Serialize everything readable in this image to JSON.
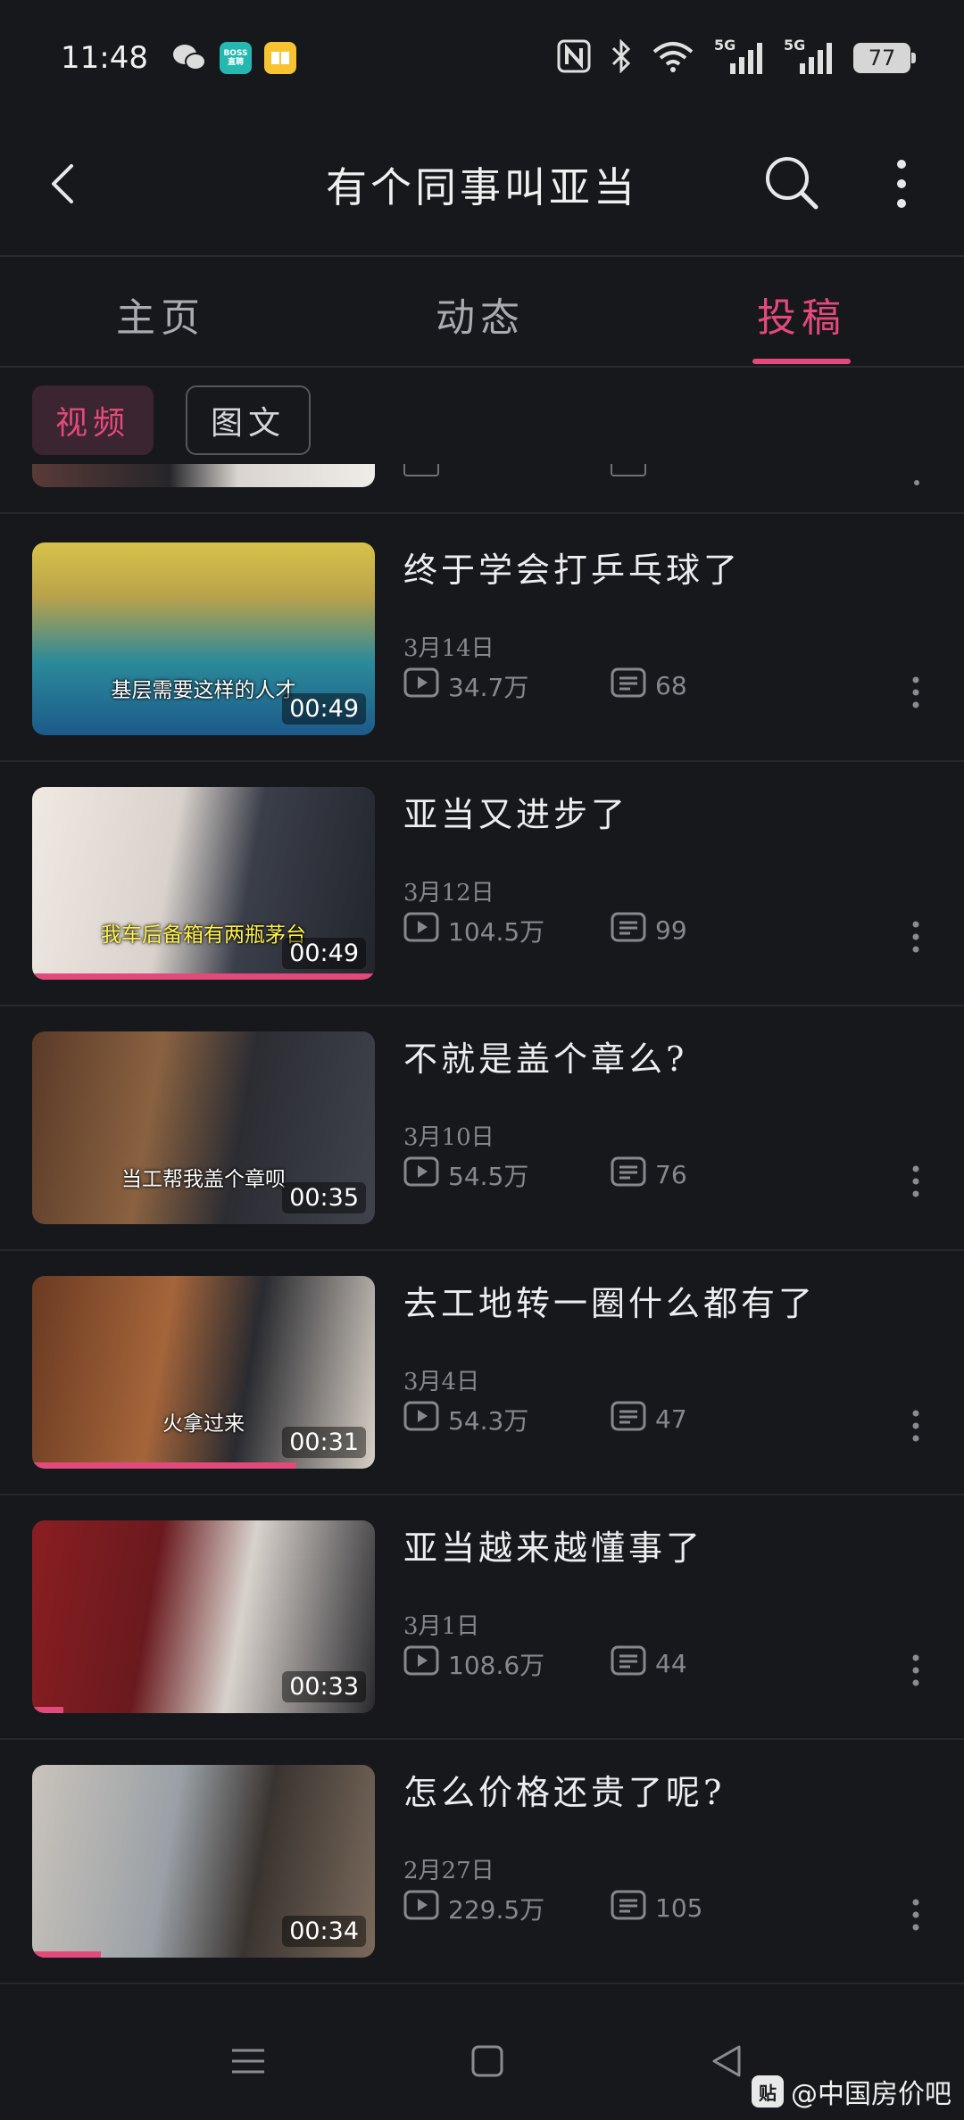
{
  "status_bar": {
    "time": "11:48",
    "battery": "77",
    "network_1": "5G",
    "network_2": "5G"
  },
  "header": {
    "title": "有个同事叫亚当"
  },
  "tabs": [
    {
      "label": "主页"
    },
    {
      "label": "动态"
    },
    {
      "label": "投稿",
      "active": true
    }
  ],
  "filters": [
    {
      "label": "视频",
      "active": true
    },
    {
      "label": "图文",
      "active": false
    }
  ],
  "videos": [
    {
      "title": "终于学会打乒乓球了",
      "date": "3月14日",
      "views": "34.7万",
      "comments": "68",
      "duration": "00:49",
      "caption": "基层需要这样的人才",
      "caption_color": "white",
      "watch_progress": 0
    },
    {
      "title": "亚当又进步了",
      "date": "3月12日",
      "views": "104.5万",
      "comments": "99",
      "duration": "00:49",
      "caption": "我车后备箱有两瓶茅台",
      "caption_color": "yellow",
      "watch_progress": 1.0
    },
    {
      "title": "不就是盖个章么?",
      "date": "3月10日",
      "views": "54.5万",
      "comments": "76",
      "duration": "00:35",
      "caption": "当工帮我盖个章呗",
      "caption_color": "white",
      "watch_progress": 0
    },
    {
      "title": "去工地转一圈什么都有了",
      "date": "3月4日",
      "views": "54.3万",
      "comments": "47",
      "duration": "00:31",
      "caption": "火拿过来",
      "caption_color": "white",
      "watch_progress": 0.77
    },
    {
      "title": "亚当越来越懂事了",
      "date": "3月1日",
      "views": "108.6万",
      "comments": "44",
      "duration": "00:33",
      "caption": "",
      "caption_color": "white",
      "watch_progress": 0.09
    },
    {
      "title": "怎么价格还贵了呢?",
      "date": "2月27日",
      "views": "229.5万",
      "comments": "105",
      "duration": "00:34",
      "caption": "",
      "caption_color": "white",
      "watch_progress": 0.2
    }
  ],
  "watermark": {
    "logo": "贴",
    "text": "@中国房价吧"
  },
  "colors": {
    "accent": "#e3497b",
    "background": "#16181c",
    "muted": "#86888d"
  }
}
